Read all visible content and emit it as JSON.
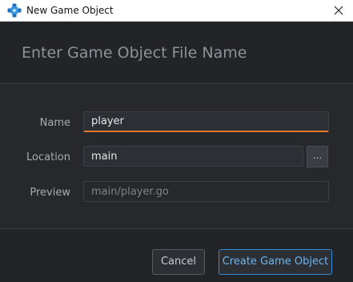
{
  "window": {
    "title": "New Game Object",
    "icon": "defold-logo-icon",
    "close_glyph": "✕"
  },
  "header": {
    "title": "Enter Game Object File Name"
  },
  "form": {
    "name": {
      "label": "Name",
      "value": "player"
    },
    "location": {
      "label": "Location",
      "value": "main",
      "browse_label": "..."
    },
    "preview": {
      "label": "Preview",
      "value": "main/player.go"
    }
  },
  "buttons": {
    "cancel": "Cancel",
    "create": "Create Game Object"
  },
  "colors": {
    "background": "#222427",
    "focus_accent": "#e8762c",
    "primary_border": "#2f8bd6",
    "primary_text": "#6cb6f2"
  }
}
